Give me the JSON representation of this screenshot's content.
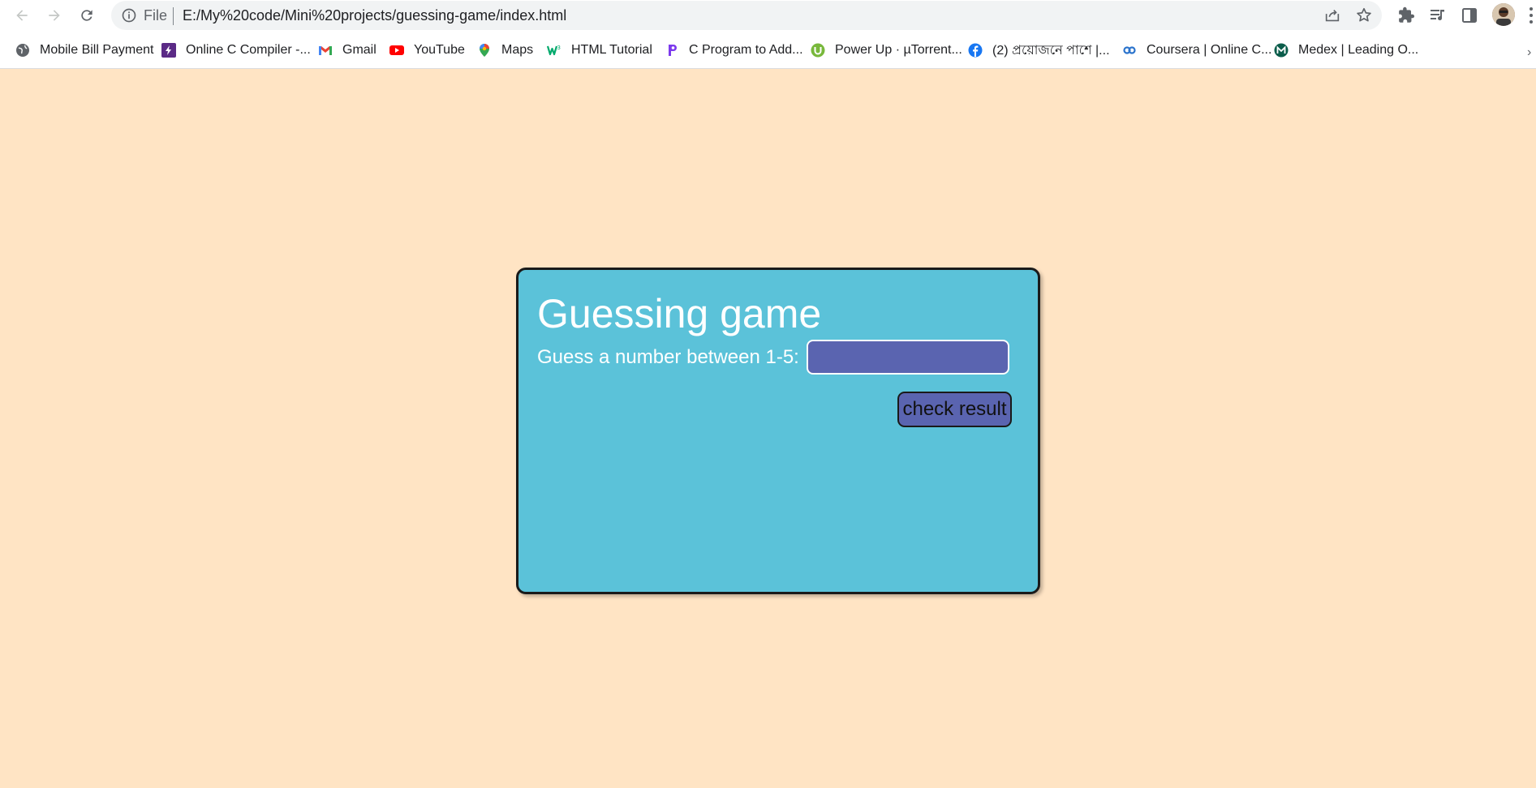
{
  "browser": {
    "omnibox": {
      "scheme_label": "File",
      "url": "E:/My%20code/Mini%20projects/guessing-game/index.html"
    },
    "toolbar_icons": [
      "back-arrow-icon",
      "forward-arrow-icon",
      "reload-icon",
      "info-icon",
      "share-icon",
      "star-icon",
      "extensions-puzzle-icon",
      "media-queue-icon",
      "side-panel-icon",
      "profile-avatar",
      "menu-dots-icon"
    ],
    "bookmarks": [
      {
        "label": "Mobile Bill Payment",
        "icon": "globe-icon",
        "color": "#5f6368"
      },
      {
        "label": "Online C Compiler -...",
        "icon": "lightning-icon",
        "color": "#5b2a86"
      },
      {
        "label": "Gmail",
        "icon": "gmail-icon",
        "color": "#ea4335"
      },
      {
        "label": "YouTube",
        "icon": "youtube-icon",
        "color": "#ff0000"
      },
      {
        "label": "Maps",
        "icon": "maps-pin-icon",
        "color": "#34a853"
      },
      {
        "label": "HTML Tutorial",
        "icon": "w3schools-icon",
        "color": "#04aa6d"
      },
      {
        "label": "C Program to Add...",
        "icon": "p-logo-icon",
        "color": "#7c3aed"
      },
      {
        "label": "Power Up · µTorrent...",
        "icon": "utorrent-icon",
        "color": "#78b83b"
      },
      {
        "label": "(2) প্রয়োজনে পাশে |...",
        "icon": "facebook-icon",
        "color": "#1877f2"
      },
      {
        "label": "Coursera | Online C...",
        "icon": "coursera-icon",
        "color": "#2a73cc"
      },
      {
        "label": "Medex | Leading O...",
        "icon": "medex-icon",
        "color": "#0b5d4b"
      }
    ],
    "bookmarks_overflow": "›"
  },
  "page": {
    "background_color": "#ffe4c4",
    "card": {
      "background_color": "#5bc2d9",
      "title": "Guessing game",
      "prompt_label": "Guess a number between 1-5:",
      "input_value": "",
      "input_color": "#5a64b0",
      "button_label": "check result"
    }
  }
}
